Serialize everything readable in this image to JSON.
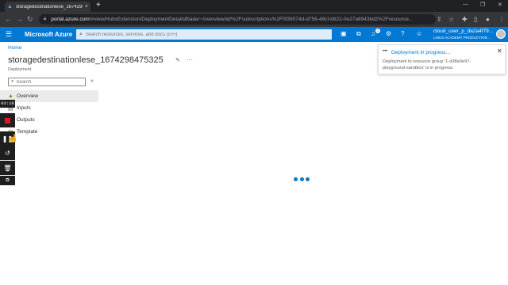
{
  "browser": {
    "tab_title": "storagedestinationlese_1674298...",
    "tab_close": "×",
    "new_tab": "+",
    "url_host": "portal.azure.com",
    "url_rest": "/#view/HubsExtension/DeploymentDetailsBlade/~/overview/id/%2Fsubscriptions%2F0f39574d-d756-48cf-b622-0e27a6943bd2%2Fresource...",
    "icons": [
      "back-icon",
      "forward-icon",
      "reload-icon",
      "lock-icon",
      "share-icon",
      "bookmark-icon",
      "extensions-icon",
      "sidebar-icon",
      "profile-icon",
      "menu-icon"
    ],
    "window_controls": [
      "minimize-icon",
      "restore-icon",
      "close-icon"
    ]
  },
  "azure_header": {
    "brand": "Microsoft Azure",
    "search_placeholder": "Search resources, services, and docs (G+/)",
    "notification_count": "1",
    "user_name": "cloud_user_p_da2a4f79...",
    "user_directory": "LINUX ACADEMY PRODUCTION ...",
    "accent_color": "#0078d4"
  },
  "page": {
    "breadcrumb": "Home",
    "breadcrumb_sep": ">",
    "title": "storagedestinationlese_1674298475325",
    "subtitle": "Deployment",
    "sidebar_search_placeholder": "Search",
    "nav_items": [
      {
        "label": "Overview",
        "active": true
      },
      {
        "label": "Inputs",
        "active": false
      },
      {
        "label": "Outputs",
        "active": false
      },
      {
        "label": "Template",
        "active": false
      }
    ]
  },
  "toast": {
    "title": "Deployment in progress...",
    "body": "Deployment to resource group '1-d38e0e97-playground-sandbox' is in progress."
  },
  "recorder": {
    "timer": "03:18"
  }
}
